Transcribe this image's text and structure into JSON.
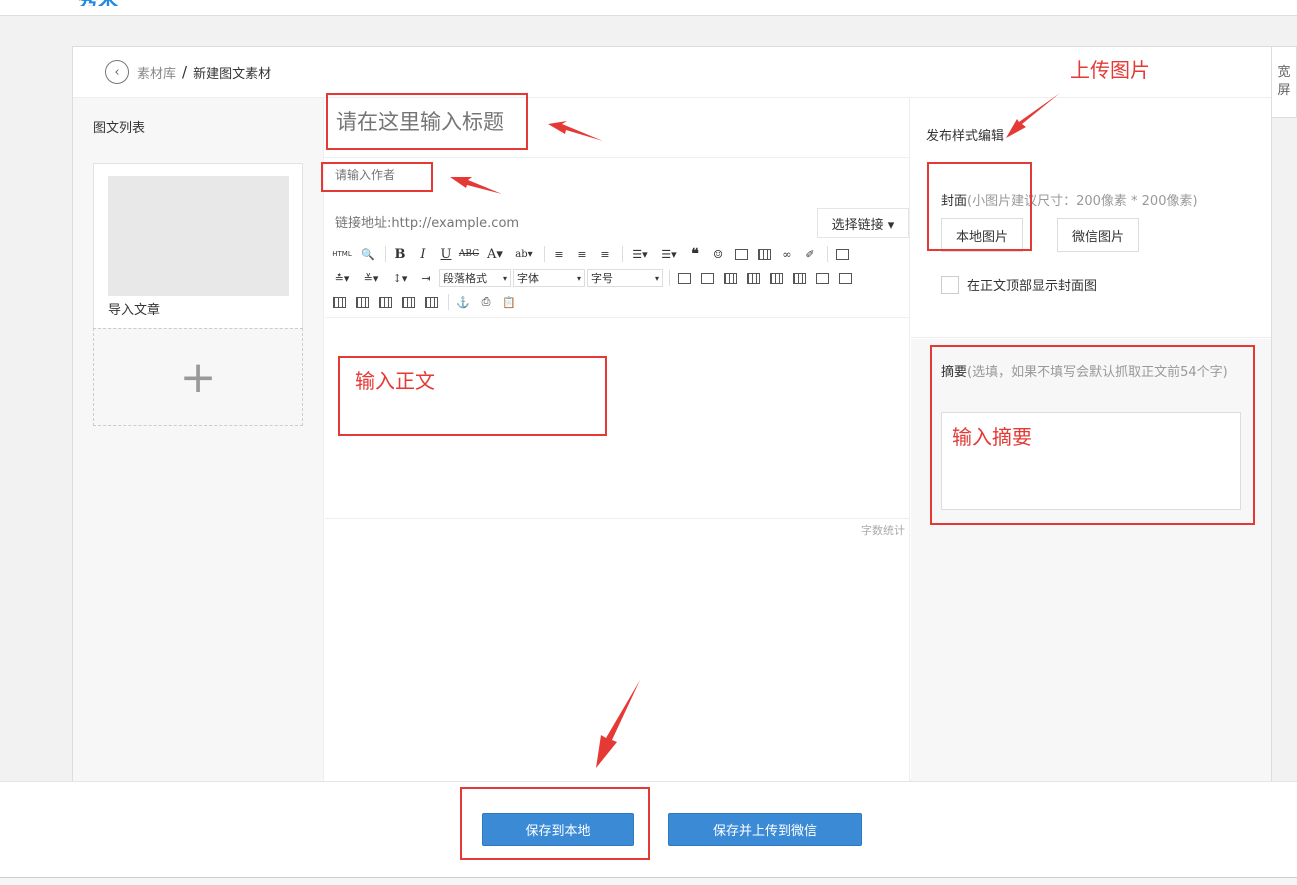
{
  "header": {
    "logo_text": "秀米"
  },
  "breadcrumb": {
    "back_label": "‹",
    "parent": "素材库",
    "separator": "/",
    "current": "新建图文素材"
  },
  "left_panel": {
    "title": "图文列表",
    "article_label": "导入文章",
    "add_label": "+"
  },
  "editor": {
    "title_placeholder": "请在这里输入标题",
    "author_placeholder": "请输入作者",
    "link_placeholder": "链接地址:http://example.com",
    "select_link_label": "选择链接 ▾",
    "paragraph_format": "段落格式",
    "font_family": "字体",
    "font_size": "字号",
    "body_placeholder": "输入正文",
    "word_count_label": "字数统计"
  },
  "right_panel": {
    "publish_style_label": "发布样式编辑",
    "cover_label": "封面",
    "cover_hint": "(小图片建议尺寸：200像素 * 200像素)",
    "local_image_button": "本地图片",
    "wechat_image_button": "微信图片",
    "show_cover_label": "在正文顶部显示封面图",
    "summary_label": "摘要",
    "summary_hint": "(选填，如果不填写会默认抓取正文前54个字)",
    "summary_placeholder": "输入摘要"
  },
  "wide_screen_tab": {
    "line1": "宽",
    "line2": "屏"
  },
  "footer": {
    "save_local_button": "保存到本地",
    "save_upload_button": "保存并上传到微信"
  },
  "annotations": {
    "upload_image": "上传图片"
  },
  "colors": {
    "annotation_red": "#e53935",
    "primary_button": "#3b8ad6"
  }
}
